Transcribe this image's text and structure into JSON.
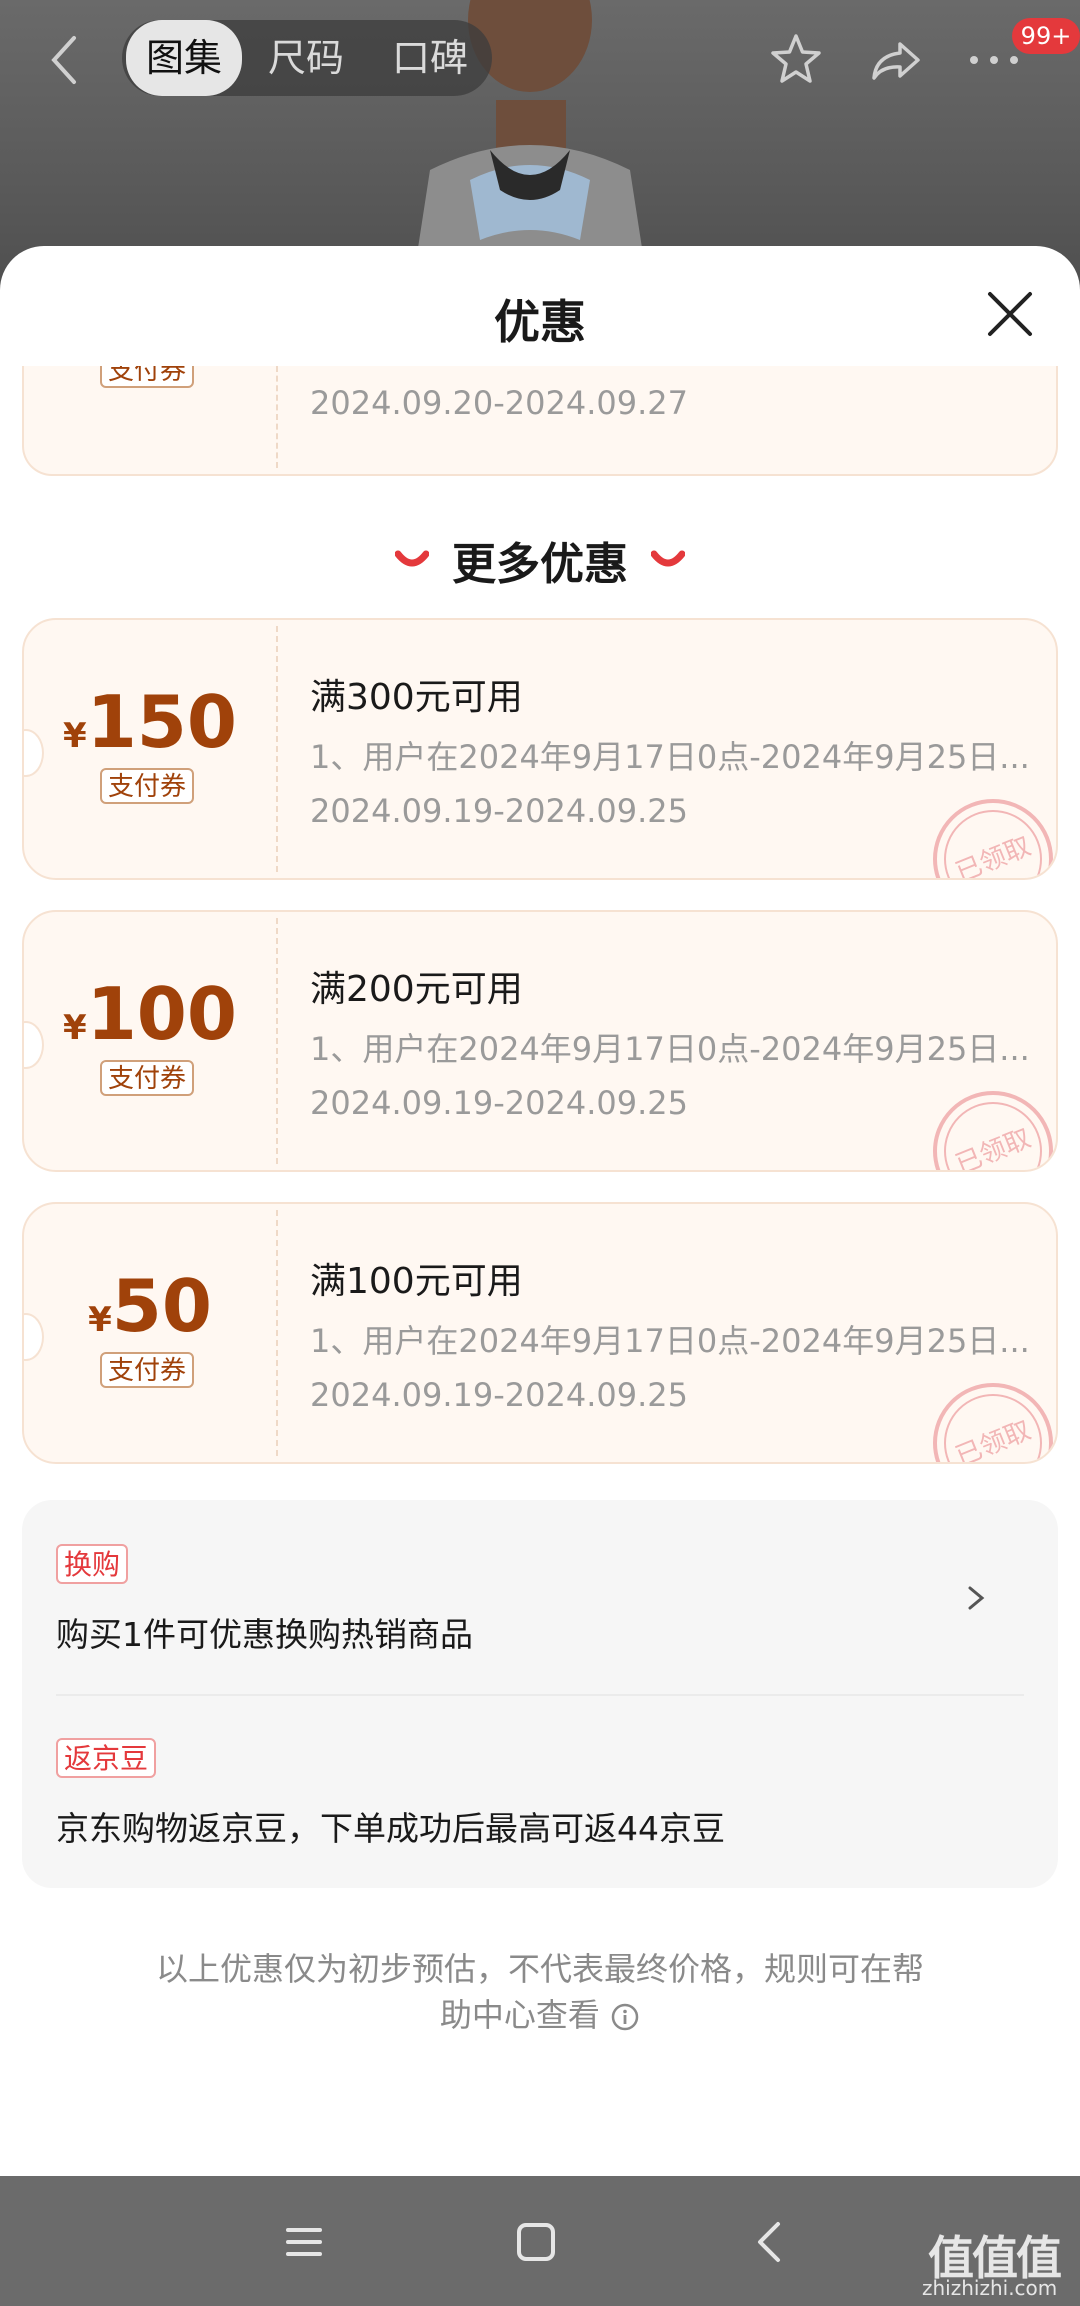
{
  "nav": {
    "tabs": [
      "图集",
      "尺码",
      "口碑"
    ],
    "active_tab": 0,
    "badge": "99+"
  },
  "sheet": {
    "title": "优惠",
    "prev_coupon": {
      "tag": "支付券",
      "date": "2024.09.20-2024.09.27"
    },
    "more_title": "更多优惠",
    "coupons": [
      {
        "currency": "¥",
        "amount": "150",
        "tag": "支付券",
        "title": "满300元可用",
        "desc": "1、用户在2024年9月17日0点-2024年9月25日...",
        "date": "2024.09.19-2024.09.25",
        "stamp": "已领取"
      },
      {
        "currency": "¥",
        "amount": "100",
        "tag": "支付券",
        "title": "满200元可用",
        "desc": "1、用户在2024年9月17日0点-2024年9月25日...",
        "date": "2024.09.19-2024.09.25",
        "stamp": "已领取"
      },
      {
        "currency": "¥",
        "amount": "50",
        "tag": "支付券",
        "title": "满100元可用",
        "desc": "1、用户在2024年9月17日0点-2024年9月25日...",
        "date": "2024.09.19-2024.09.25",
        "stamp": "已领取"
      }
    ],
    "promos": [
      {
        "tag": "换购",
        "text": "购买1件可优惠换购热销商品"
      },
      {
        "tag": "返京豆",
        "text": "京东购物返京豆，下单成功后最高可返44京豆"
      }
    ],
    "footnote_line1": "以上优惠仅为初步预估，不代表最终价格，规则可在帮",
    "footnote_line2": "助中心查看"
  },
  "watermark": {
    "text": "值值值",
    "url": "zhizhizhi.com"
  },
  "colors": {
    "accent": "#e4393c",
    "coupon_amount": "#a0420a",
    "coupon_bg": "#fff8f2"
  }
}
